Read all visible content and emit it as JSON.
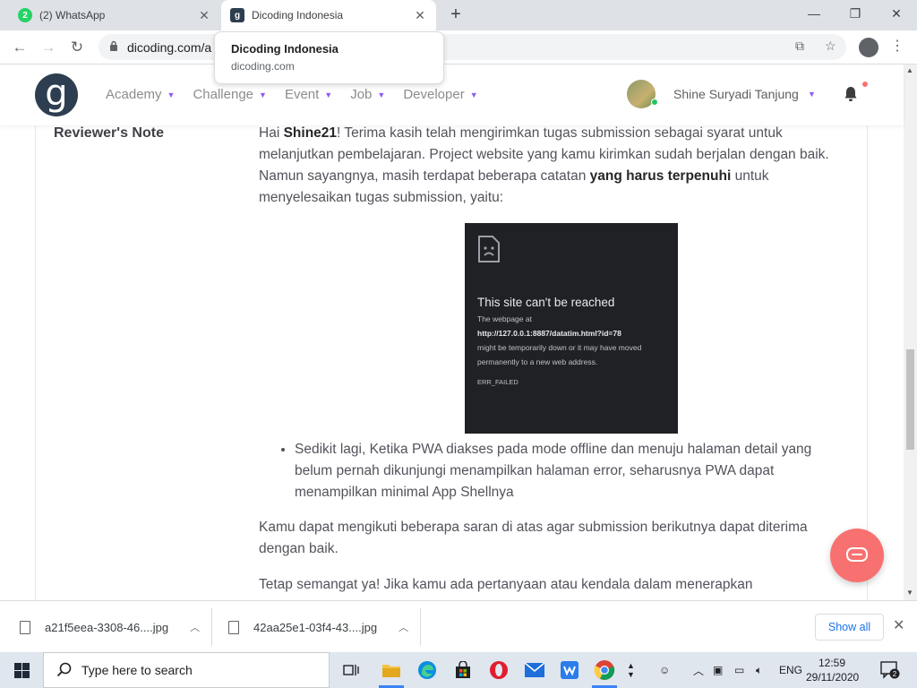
{
  "browser": {
    "tabs": [
      {
        "title": "(2) WhatsApp",
        "badge": "2"
      },
      {
        "title": "Dicoding Indonesia"
      }
    ],
    "url": "dicoding.com/a",
    "tooltip": {
      "title": "Dicoding Indonesia",
      "url": "dicoding.com"
    }
  },
  "site": {
    "logo": "g",
    "nav": [
      "Academy",
      "Challenge",
      "Event",
      "Job",
      "Developer"
    ],
    "user_name": "Shine Suryadi Tanjung"
  },
  "review": {
    "label": "Reviewer's Note",
    "greeting_pre": "Hai ",
    "username": "Shine21",
    "greeting_post": "! Terima kasih telah mengirimkan tugas submission sebagai syarat untuk melanjutkan pembelajaran. Project website yang kamu kirimkan sudah berjalan dengan baik. Namun sayangnya, masih terdapat beberapa catatan ",
    "emphasis": "yang harus terpenuhi",
    "greeting_end": " untuk menyelesaikan tugas submission, yaitu:",
    "error_screenshot": {
      "title": "This site can't be reached",
      "line1": "The webpage at",
      "url": "http://127.0.0.1:8887/datatim.html?id=78",
      "line2": "might be temporarily down or it may have moved",
      "line3": "permanently to a new web address.",
      "code": "ERR_FAILED"
    },
    "bullets": [
      "Sedikit lagi, Ketika PWA diakses pada mode offline dan menuju halaman detail yang belum pernah dikunjungi menampilkan halaman error, seharusnya PWA dapat menampilkan minimal App Shellnya"
    ],
    "paragraph2": "Kamu dapat mengikuti beberapa saran di atas agar submission berikutnya dapat diterima dengan baik.",
    "paragraph3": "Tetap semangat ya! Jika kamu ada pertanyaan atau kendala dalam menerapkan"
  },
  "downloads": {
    "files": [
      "a21f5eea-3308-46....jpg",
      "42aa25e1-03f4-43....jpg"
    ],
    "show_all": "Show all"
  },
  "taskbar": {
    "search_placeholder": "Type here to search",
    "language": "ENG",
    "time": "12:59",
    "date": "29/11/2020",
    "notification_count": "2"
  },
  "colors": {
    "accent_purple": "#8b5cf6",
    "chat_button": "#f87171",
    "logo_bg": "#2d3e50"
  }
}
